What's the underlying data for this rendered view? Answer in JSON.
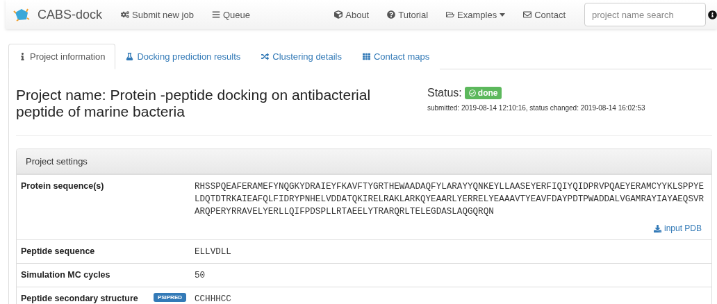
{
  "navbar": {
    "brand": "CABS-dock",
    "items": [
      {
        "label": "Submit new job",
        "dropdown": false
      },
      {
        "label": "Queue",
        "dropdown": false
      },
      {
        "label": "About",
        "dropdown": false
      },
      {
        "label": "Tutorial",
        "dropdown": false
      },
      {
        "label": "Examples",
        "dropdown": true
      },
      {
        "label": "Contact",
        "dropdown": false
      }
    ],
    "search": {
      "placeholder": "project name search"
    }
  },
  "tabs": [
    {
      "label": "Project information",
      "selected": true
    },
    {
      "label": "Docking prediction results",
      "selected": false
    },
    {
      "label": "Clustering details",
      "selected": false
    },
    {
      "label": "Contact maps",
      "selected": false
    }
  ],
  "project": {
    "title": "Project name: Protein -peptide docking on antibacterial peptide of marine bacteria",
    "status_label": "Status:",
    "status": "done",
    "timestamps": "submitted: 2019-08-14 12:10:16, status changed: 2019-08-14 16:02:53"
  },
  "settings": {
    "heading": "Project settings",
    "rows": [
      {
        "label": "Protein sequence(s)",
        "lines": [
          "RHSSPQEAFERAMEFYNQGKYDRAIEYFKAVFTYGRTHEWAADAQFYLARAYYQNKEYLLAASEYERFIQIYQIDPRVPQAEYERAMCYYKLSPPYE",
          "LDQTDTRKAIEAFQLFIDRYPNHELVDDATQKIRELRAKLARKQYEAARLYERRELYEAAAVTYEAVFDAYPDTPWADDALVGAMRAYIAYAEQSVR",
          "ARQPERYRRAVELYERLLQIFPDSPLLRTAEELYTRARQRLTELEGDASLAQGQRQN"
        ],
        "link": "input PDB"
      },
      {
        "label": "Peptide sequence",
        "lines": [
          "ELLVDLL"
        ]
      },
      {
        "label": "Simulation MC cycles",
        "lines": [
          "50"
        ]
      },
      {
        "label": "Peptide secondary structure",
        "badge": "PSIPRED",
        "lines": [
          "CCHHHCC"
        ]
      }
    ]
  }
}
